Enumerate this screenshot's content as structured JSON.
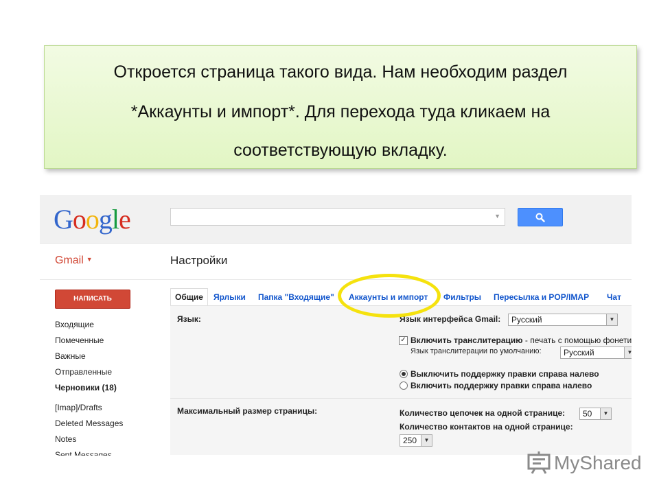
{
  "caption": {
    "line1": "Откроется страница такого вида. Нам необходим раздел",
    "line2": "*Аккаунты и импорт*.  Для перехода туда кликаем на",
    "line3": "соответствующую вкладку."
  },
  "header": {
    "logo": [
      "G",
      "o",
      "o",
      "g",
      "l",
      "e"
    ],
    "search_placeholder": ""
  },
  "subheader": {
    "app_label": "Gmail",
    "page_title": "Настройки"
  },
  "sidebar": {
    "compose_label": "НАПИСАТЬ",
    "folders": [
      {
        "label": "Входящие",
        "bold": false
      },
      {
        "label": "Помеченные",
        "bold": false
      },
      {
        "label": "Важные",
        "bold": false
      },
      {
        "label": "Отправленные",
        "bold": false
      },
      {
        "label": "Черновики (18)",
        "bold": true
      },
      {
        "label": "[Imap]/Drafts",
        "bold": false
      },
      {
        "label": "Deleted Messages",
        "bold": false
      },
      {
        "label": "Notes",
        "bold": false
      },
      {
        "label": "Sent Messages",
        "bold": false
      }
    ]
  },
  "tabs": [
    {
      "label": "Общие",
      "active": true
    },
    {
      "label": "Ярлыки",
      "active": false
    },
    {
      "label": "Папка \"Входящие\"",
      "active": false
    },
    {
      "label": "Аккаунты и импорт",
      "active": false
    },
    {
      "label": "Фильтры",
      "active": false
    },
    {
      "label": "Пересылка и POP/IMAP",
      "active": false
    },
    {
      "label": "Чат",
      "active": false
    }
  ],
  "settings": {
    "language": {
      "label": "Язык:",
      "interface_label": "Язык интерфейса Gmail:",
      "interface_value": "Русский",
      "translit_checkbox_label": "Включить транслитерацию",
      "translit_desc": " - печать с помощью фонетической",
      "translit_default_label": "Язык транслитерации по умолчанию:",
      "translit_default_value": "Русский",
      "rtl_off": "Выключить поддержку правки справа налево",
      "rtl_on": "Включить поддержку правки справа налево"
    },
    "page_size": {
      "label": "Максимальный размер страницы:",
      "threads_label": "Количество цепочек на одной странице:",
      "threads_value": "50",
      "contacts_label": "Количество контактов на одной странице:",
      "contacts_value": "250"
    }
  },
  "watermark": {
    "text": "MyShared"
  },
  "colors": {
    "compose": "#d14836",
    "link": "#1155cc",
    "search_button": "#4d90fe",
    "highlight": "#f5e20e",
    "caption_bg": "#e2f6c4"
  }
}
